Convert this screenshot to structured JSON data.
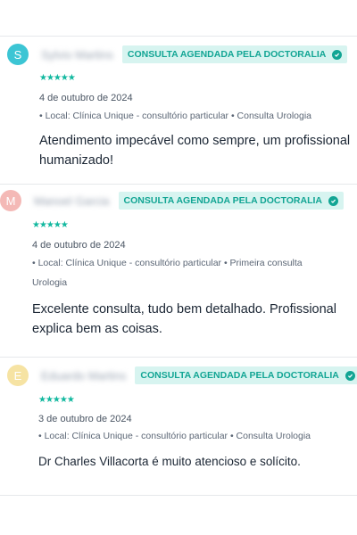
{
  "reviews": [
    {
      "initial": "S",
      "avatar_color": "#3cc5d4",
      "name": "Sylvio Martins",
      "badge": "CONSULTA AGENDADA PELA DOCTORALIA",
      "rating": 5,
      "stars": "★★★★★",
      "date": "4 de outubro de 2024",
      "meta": "• Local: Clínica Unique - consultório particular • Consulta Urologia",
      "comment": "Atendimento impecável como sempre, um profissional humanizado!"
    },
    {
      "initial": "M",
      "avatar_color": "#f4b9b6",
      "name": "Manoel Garcia",
      "badge": "CONSULTA AGENDADA PELA DOCTORALIA",
      "rating": 5,
      "stars": "★★★★★",
      "date": "4 de outubro de 2024",
      "meta": "• Local: Clínica Unique - consultório particular • Primeira consulta Urologia",
      "comment": "Excelente consulta, tudo bem detalhado. Profissional explica bem as coisas."
    },
    {
      "initial": "E",
      "avatar_color": "#f6e3a3",
      "name": "Eduardo Martins",
      "badge": "CONSULTA AGENDADA PELA DOCTORALIA",
      "rating": 5,
      "stars": "★★★★★",
      "date": "3 de outubro de 2024",
      "meta": "• Local: Clínica Unique - consultório particular • Consulta Urologia",
      "comment": "Dr Charles Villacorta é muito atencioso e solícito."
    }
  ],
  "colors": {
    "accent": "#12a594",
    "badge_bg": "#d7f4f0"
  }
}
